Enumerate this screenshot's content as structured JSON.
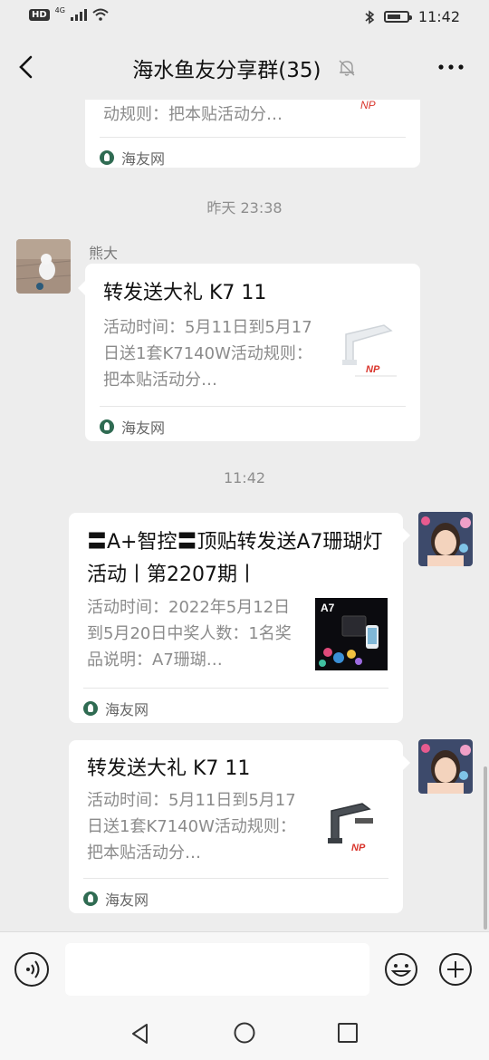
{
  "statusbar": {
    "badge": "HD",
    "network": "4G",
    "time": "11:42"
  },
  "header": {
    "title": "海水鱼友分享群(35)",
    "icons": [
      "back-arrow-icon",
      "mute-bell-icon",
      "more-dots-icon"
    ]
  },
  "messages": [
    {
      "type": "link-card",
      "side": "left",
      "partial": true,
      "desc_tail": "动规则：把本贴活动分…",
      "source": "海友网"
    },
    {
      "type": "timestamp",
      "text": "昨天 23:38"
    },
    {
      "type": "link-card",
      "side": "left",
      "sender": "熊大",
      "title": "转发送大礼 K7 11",
      "desc": "活动时间：5月11日到5月17日送1套K7140W活动规则：把本贴活动分…",
      "source": "海友网"
    },
    {
      "type": "timestamp",
      "text": "11:42"
    },
    {
      "type": "link-card",
      "side": "right",
      "title": "〓A+智控〓顶贴转发送A7珊瑚灯活动丨第2207期丨",
      "desc": "活动时间：2022年5月12日到5月20日中奖人数：1名奖品说明：A7珊瑚…",
      "thumb_label": "A7",
      "source": "海友网"
    },
    {
      "type": "link-card",
      "side": "right",
      "title": "转发送大礼 K7 11",
      "desc": "活动时间：5月11日到5月17日送1套K7140W活动规则：把本贴活动分…",
      "source": "海友网"
    }
  ],
  "input": {
    "placeholder": ""
  },
  "colors": {
    "background": "#ededed",
    "card": "#ffffff",
    "source_icon": "#2f6b52",
    "thumb_brand": "#d9342b"
  }
}
